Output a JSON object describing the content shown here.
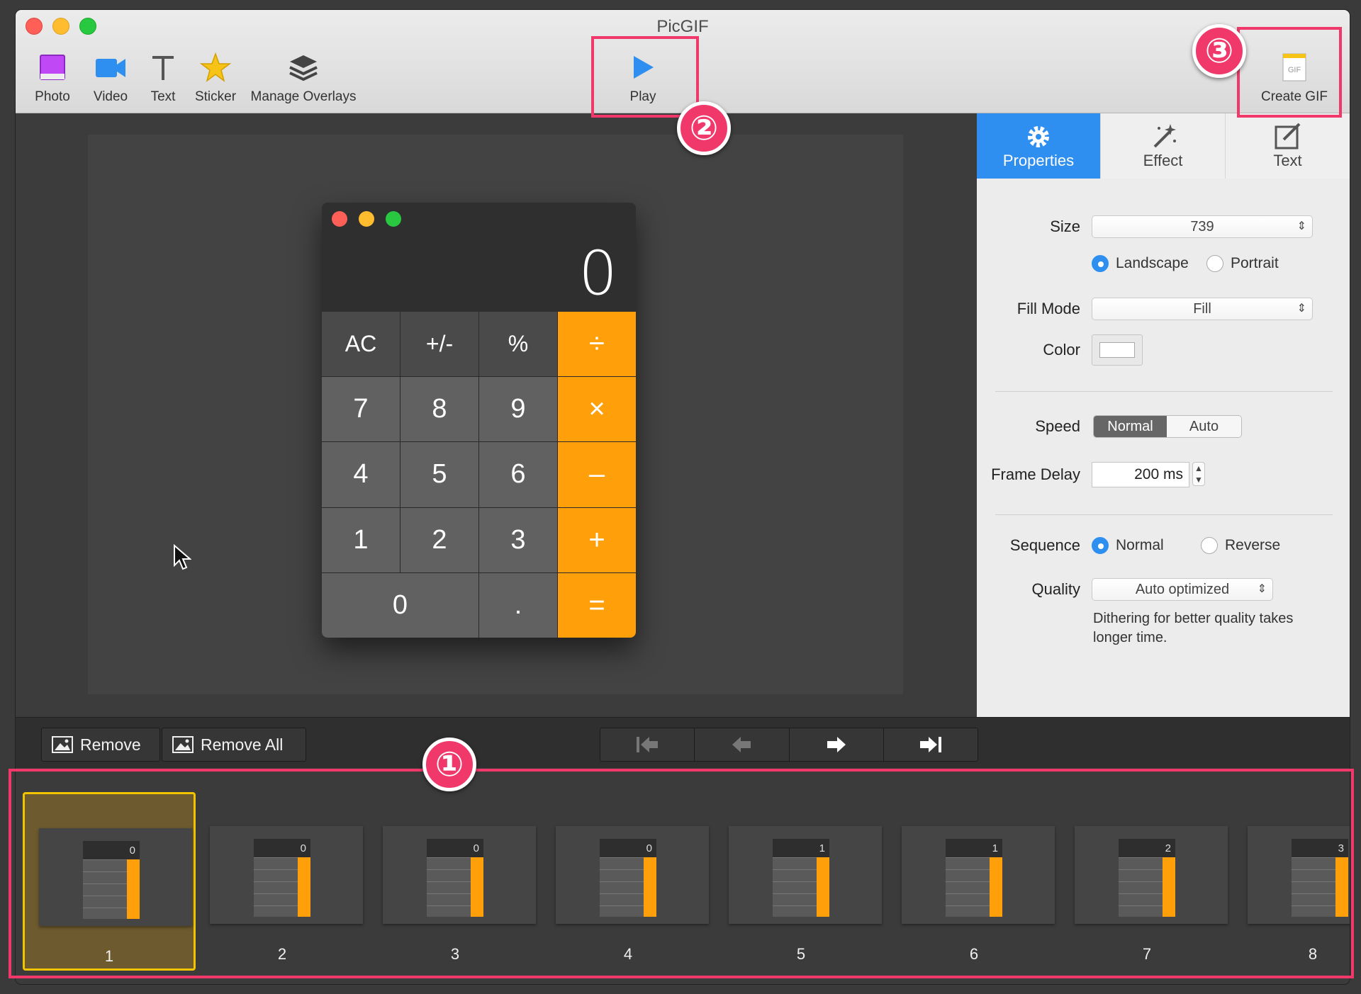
{
  "window": {
    "title": "PicGIF"
  },
  "toolbar": {
    "photo": "Photo",
    "video": "Video",
    "text": "Text",
    "sticker": "Sticker",
    "manage_overlays": "Manage Overlays",
    "play": "Play",
    "create_gif": "Create GIF",
    "gif_icon_text": "GIF"
  },
  "calculator": {
    "display": "0",
    "keys": [
      "AC",
      "+/-",
      "%",
      "÷",
      "7",
      "8",
      "9",
      "×",
      "4",
      "5",
      "6",
      "–",
      "1",
      "2",
      "3",
      "+",
      "0",
      ".",
      "="
    ]
  },
  "panel": {
    "tabs": [
      "Properties",
      "Effect",
      "Text"
    ],
    "size_label": "Size",
    "size_value": "739",
    "landscape": "Landscape",
    "portrait": "Portrait",
    "fill_mode_label": "Fill Mode",
    "fill_mode_value": "Fill",
    "color_label": "Color",
    "speed_label": "Speed",
    "speed_normal": "Normal",
    "speed_auto": "Auto",
    "frame_delay_label": "Frame Delay",
    "frame_delay_value": "200 ms",
    "sequence_label": "Sequence",
    "seq_normal": "Normal",
    "seq_reverse": "Reverse",
    "quality_label": "Quality",
    "quality_value": "Auto optimized",
    "quality_note": "Dithering for better quality takes longer time."
  },
  "bottom": {
    "remove": "Remove",
    "remove_all": "Remove All"
  },
  "frames": [
    {
      "num": "1",
      "display": "0"
    },
    {
      "num": "2",
      "display": "0"
    },
    {
      "num": "3",
      "display": "0"
    },
    {
      "num": "4",
      "display": "0"
    },
    {
      "num": "5",
      "display": "1"
    },
    {
      "num": "6",
      "display": "1"
    },
    {
      "num": "7",
      "display": "2"
    },
    {
      "num": "8",
      "display": "3"
    }
  ],
  "callouts": {
    "one": "①",
    "two": "②",
    "three": "③"
  },
  "colors": {
    "accent": "#2e8ff0",
    "highlight": "#f0386b",
    "calc_orange": "#ff9f0a"
  }
}
